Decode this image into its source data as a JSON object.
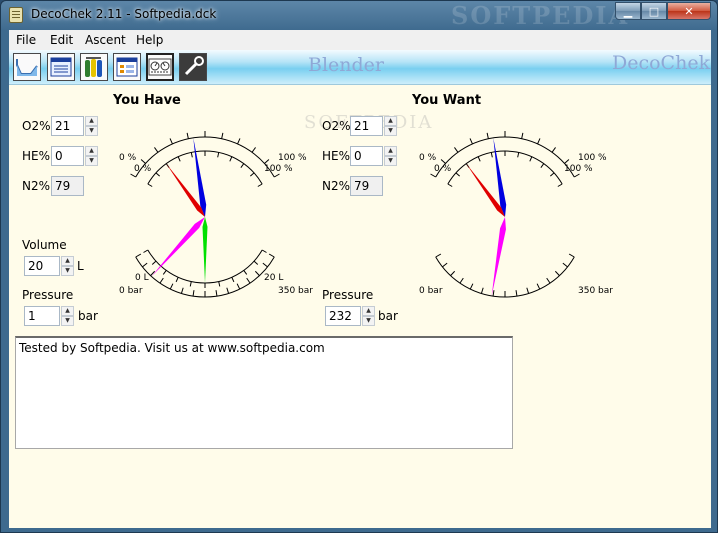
{
  "window": {
    "title": "DecoChek 2.11 - Softpedia.dck",
    "watermark": "SOFTPEDIA"
  },
  "menu": [
    "File",
    "Edit",
    "Ascent",
    "Help"
  ],
  "toolbar": {
    "brand_left": "Blender",
    "brand_right": "DecoChek"
  },
  "have": {
    "title": "You Have",
    "o2_label": "O2%",
    "o2": "21",
    "he_label": "HE%",
    "he": "0",
    "n2_label": "N2%",
    "n2": "79",
    "volume_label": "Volume",
    "volume": "20",
    "volume_unit": "L",
    "pressure_label": "Pressure",
    "pressure": "1",
    "pressure_unit": "bar"
  },
  "want": {
    "title": "You Want",
    "o2_label": "O2%",
    "o2": "21",
    "he_label": "HE%",
    "he": "0",
    "n2_label": "N2%",
    "n2": "79",
    "pressure_label": "Pressure",
    "pressure": "232",
    "pressure_unit": "bar"
  },
  "gauge_labels": {
    "pct_min": "0 %",
    "pct_max": "100 %",
    "vol_min": "0 L",
    "vol_max": "20 L",
    "bar_min": "0 bar",
    "bar_max": "350 bar"
  },
  "colors": {
    "o2": "#0000e0",
    "he": "#e00000",
    "volume": "#00e000",
    "pressure": "#ff00ff"
  },
  "notes": "Tested by Softpedia. Visit us at www.softpedia.com",
  "center_watermark": "SOFTPEDIA"
}
